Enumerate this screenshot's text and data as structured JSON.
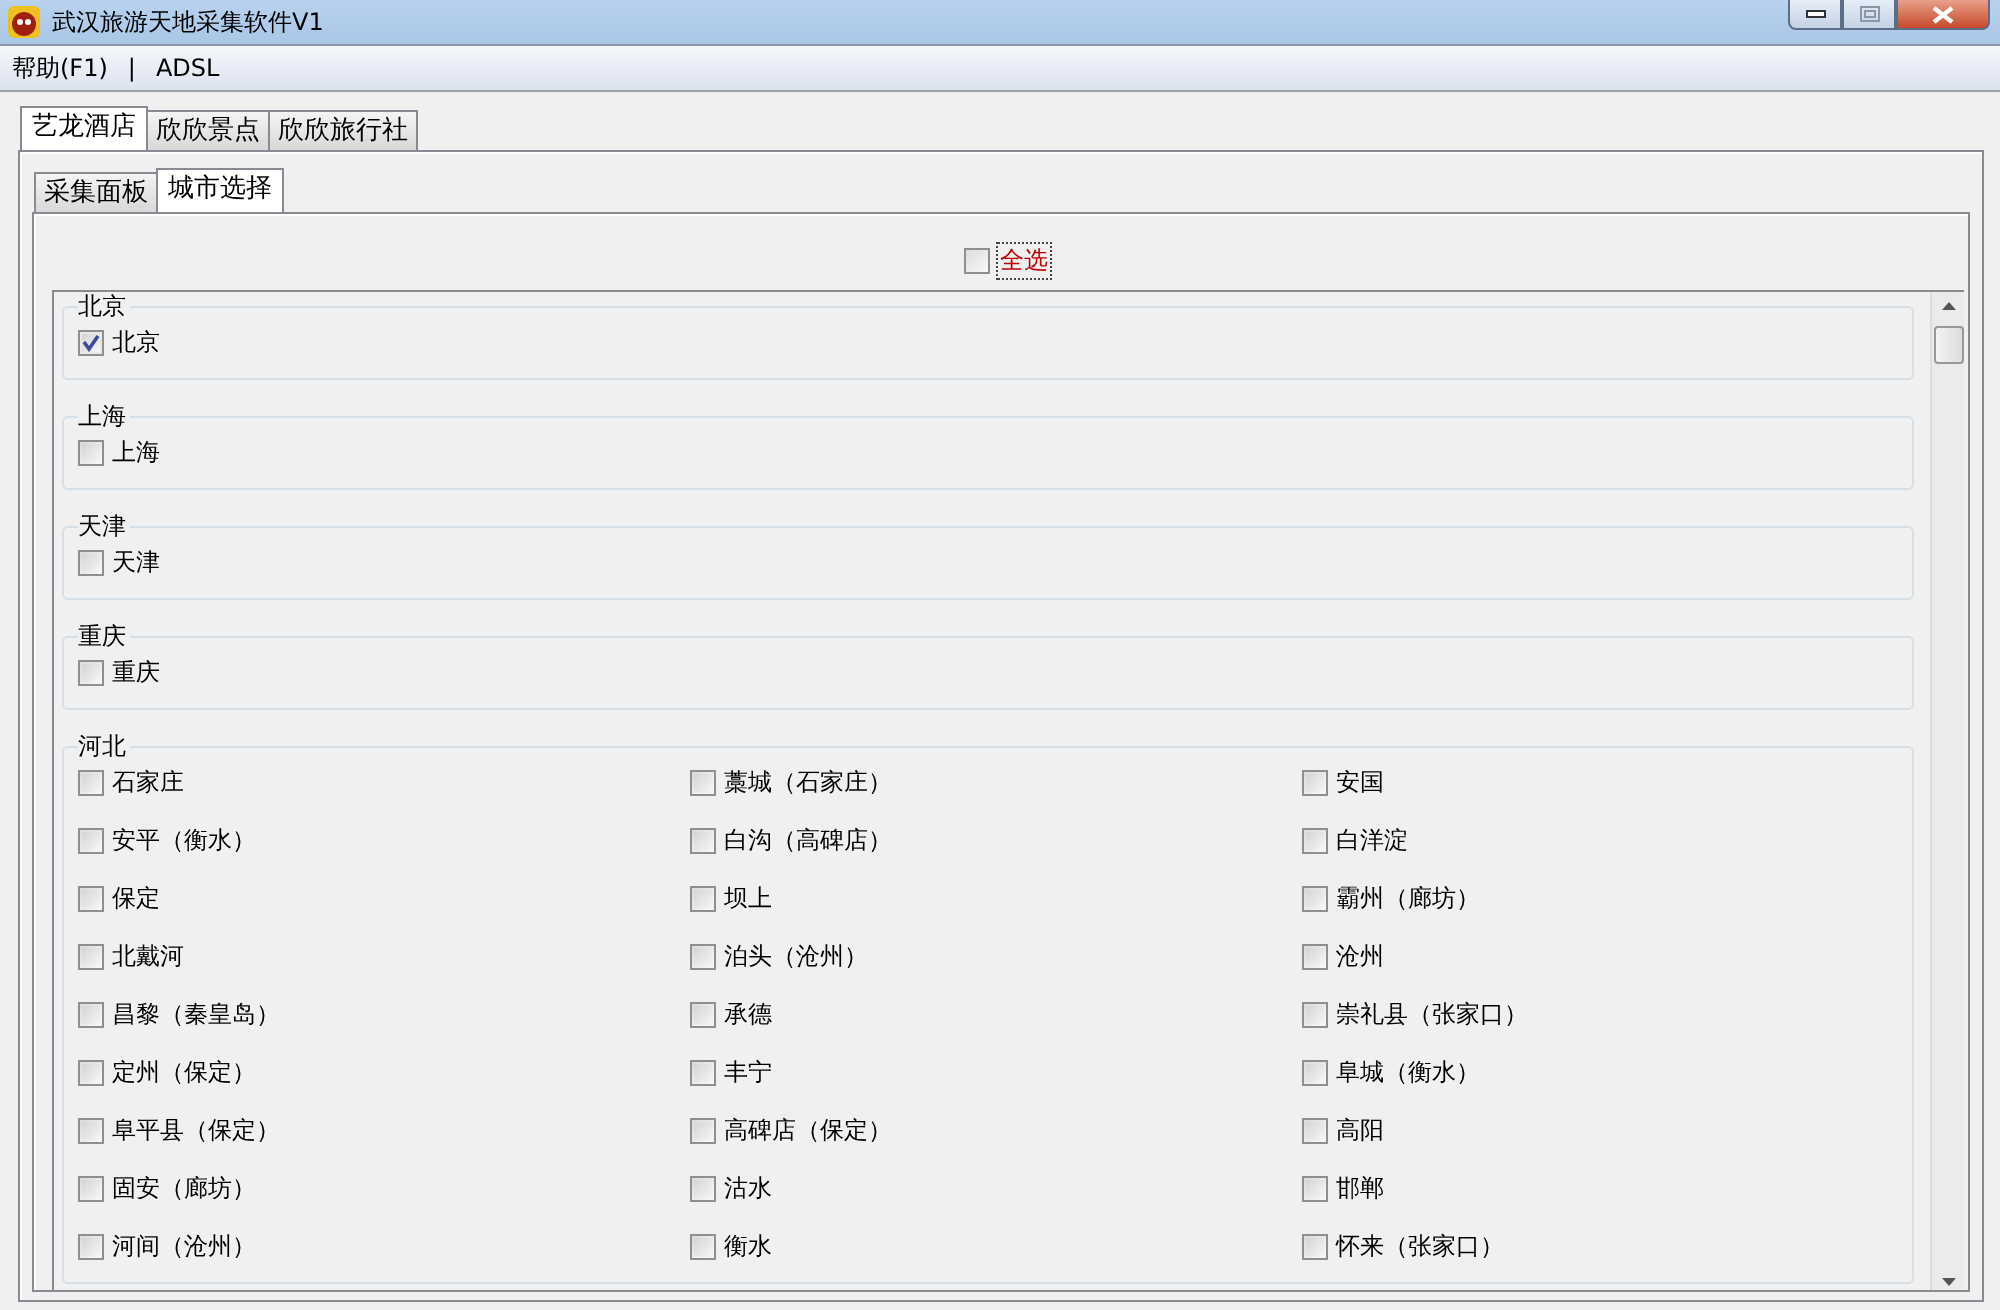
{
  "window": {
    "title": "武汉旅游天地采集软件V1"
  },
  "menu": {
    "items": [
      {
        "label": "帮助(F1)"
      },
      {
        "label": "ADSL"
      }
    ],
    "separator": "|"
  },
  "tabs": [
    {
      "label": "艺龙酒店",
      "selected": true
    },
    {
      "label": "欣欣景点",
      "selected": false
    },
    {
      "label": "欣欣旅行社",
      "selected": false
    }
  ],
  "subtabs": [
    {
      "label": "采集面板",
      "selected": false
    },
    {
      "label": "城市选择",
      "selected": true
    }
  ],
  "select_all": {
    "label": "全选",
    "checked": false,
    "focused": true
  },
  "groups": [
    {
      "title": "北京",
      "items": [
        {
          "label": "北京",
          "checked": true
        }
      ]
    },
    {
      "title": "上海",
      "items": [
        {
          "label": "上海",
          "checked": false
        }
      ]
    },
    {
      "title": "天津",
      "items": [
        {
          "label": "天津",
          "checked": false
        }
      ]
    },
    {
      "title": "重庆",
      "items": [
        {
          "label": "重庆",
          "checked": false
        }
      ]
    },
    {
      "title": "河北",
      "items": [
        {
          "label": "石家庄",
          "checked": false
        },
        {
          "label": "藁城（石家庄）",
          "checked": false
        },
        {
          "label": "安国",
          "checked": false
        },
        {
          "label": "安平（衡水）",
          "checked": false
        },
        {
          "label": "白沟（高碑店）",
          "checked": false
        },
        {
          "label": "白洋淀",
          "checked": false
        },
        {
          "label": "保定",
          "checked": false
        },
        {
          "label": "坝上",
          "checked": false
        },
        {
          "label": "霸州（廊坊）",
          "checked": false
        },
        {
          "label": "北戴河",
          "checked": false
        },
        {
          "label": "泊头（沧州）",
          "checked": false
        },
        {
          "label": "沧州",
          "checked": false
        },
        {
          "label": "昌黎（秦皇岛）",
          "checked": false
        },
        {
          "label": "承德",
          "checked": false
        },
        {
          "label": "崇礼县（张家口）",
          "checked": false
        },
        {
          "label": "定州（保定）",
          "checked": false
        },
        {
          "label": "丰宁",
          "checked": false
        },
        {
          "label": "阜城（衡水）",
          "checked": false
        },
        {
          "label": "阜平县（保定）",
          "checked": false
        },
        {
          "label": "高碑店（保定）",
          "checked": false
        },
        {
          "label": "高阳",
          "checked": false
        },
        {
          "label": "固安（廊坊）",
          "checked": false
        },
        {
          "label": "沽水",
          "checked": false
        },
        {
          "label": "邯郸",
          "checked": false
        },
        {
          "label": "河间（沧州）",
          "checked": false
        },
        {
          "label": "衡水",
          "checked": false
        },
        {
          "label": "怀来（张家口）",
          "checked": false
        }
      ]
    }
  ]
}
